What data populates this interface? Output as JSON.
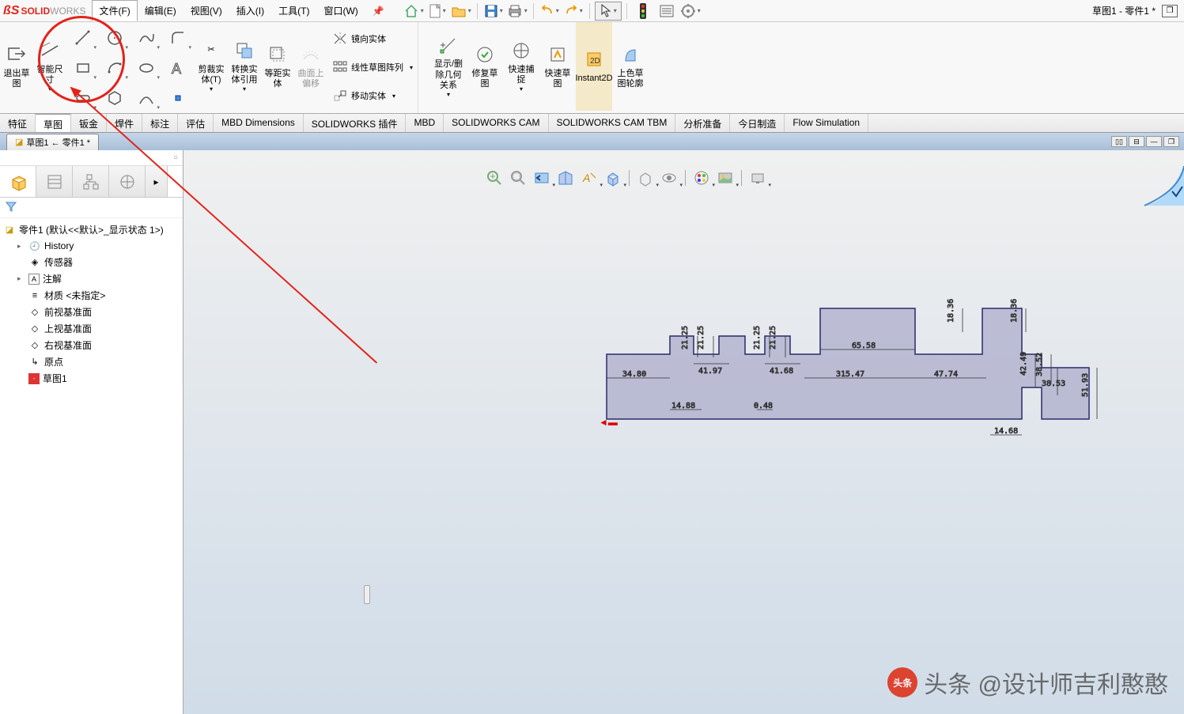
{
  "app": {
    "name": "SOLIDWORKS",
    "name_prefix": "SOLID",
    "name_suffix": "WORKS"
  },
  "doc_title": "草图1 - 零件1 *",
  "menu": {
    "file": "文件(F)",
    "edit": "编辑(E)",
    "view": "视图(V)",
    "insert": "插入(I)",
    "tools": "工具(T)",
    "window": "窗口(W)",
    "pin": "📌"
  },
  "ribbon": {
    "exit_sketch": "退出草图",
    "smart_dim": "智能尺寸",
    "trim": "剪裁实体(T)",
    "convert": "转换实体引用",
    "offset": "等距实体",
    "surface_offset": "曲面上偏移",
    "mirror": "镜向实体",
    "linear_pattern": "线性草图阵列",
    "move": "移动实体",
    "show_del": "显示/删除几何关系",
    "repair": "修复草图",
    "quick_snap": "快速捕捉",
    "rapid": "快速草图",
    "instant2d": "Instant2D",
    "shaded": "上色草图轮廓"
  },
  "ribbon_tabs": [
    "特征",
    "草图",
    "钣金",
    "焊件",
    "标注",
    "评估",
    "MBD Dimensions",
    "SOLIDWORKS 插件",
    "MBD",
    "SOLIDWORKS CAM",
    "SOLIDWORKS CAM TBM",
    "分析准备",
    "今日制造",
    "Flow Simulation"
  ],
  "doctab": "草图1 ← 零件1 *",
  "tree": {
    "root": "零件1 (默认<<默认>_显示状态 1>)",
    "history": "History",
    "sensors": "传感器",
    "annotations": "注解",
    "material": "材质 <未指定>",
    "front": "前视基准面",
    "top": "上视基准面",
    "right": "右视基准面",
    "origin": "原点",
    "sketch1": "草图1"
  },
  "dims": {
    "d1": "34.80",
    "d2": "14.88",
    "d3": "0.48",
    "d4": "41.97",
    "d5": "21.25",
    "d5b": "21.25",
    "d6": "41.68",
    "d7": "21.25",
    "d7b": "21.25",
    "d8": "315.47",
    "d9": "65.58",
    "d10": "18.36",
    "d11": "47.74",
    "d12": "18.36",
    "d13": "42.49",
    "d14": "38.53",
    "d14b": "38.52",
    "d15": "51.93",
    "d16": "14.68"
  },
  "watermark": "头条 @设计师吉利憨憨"
}
